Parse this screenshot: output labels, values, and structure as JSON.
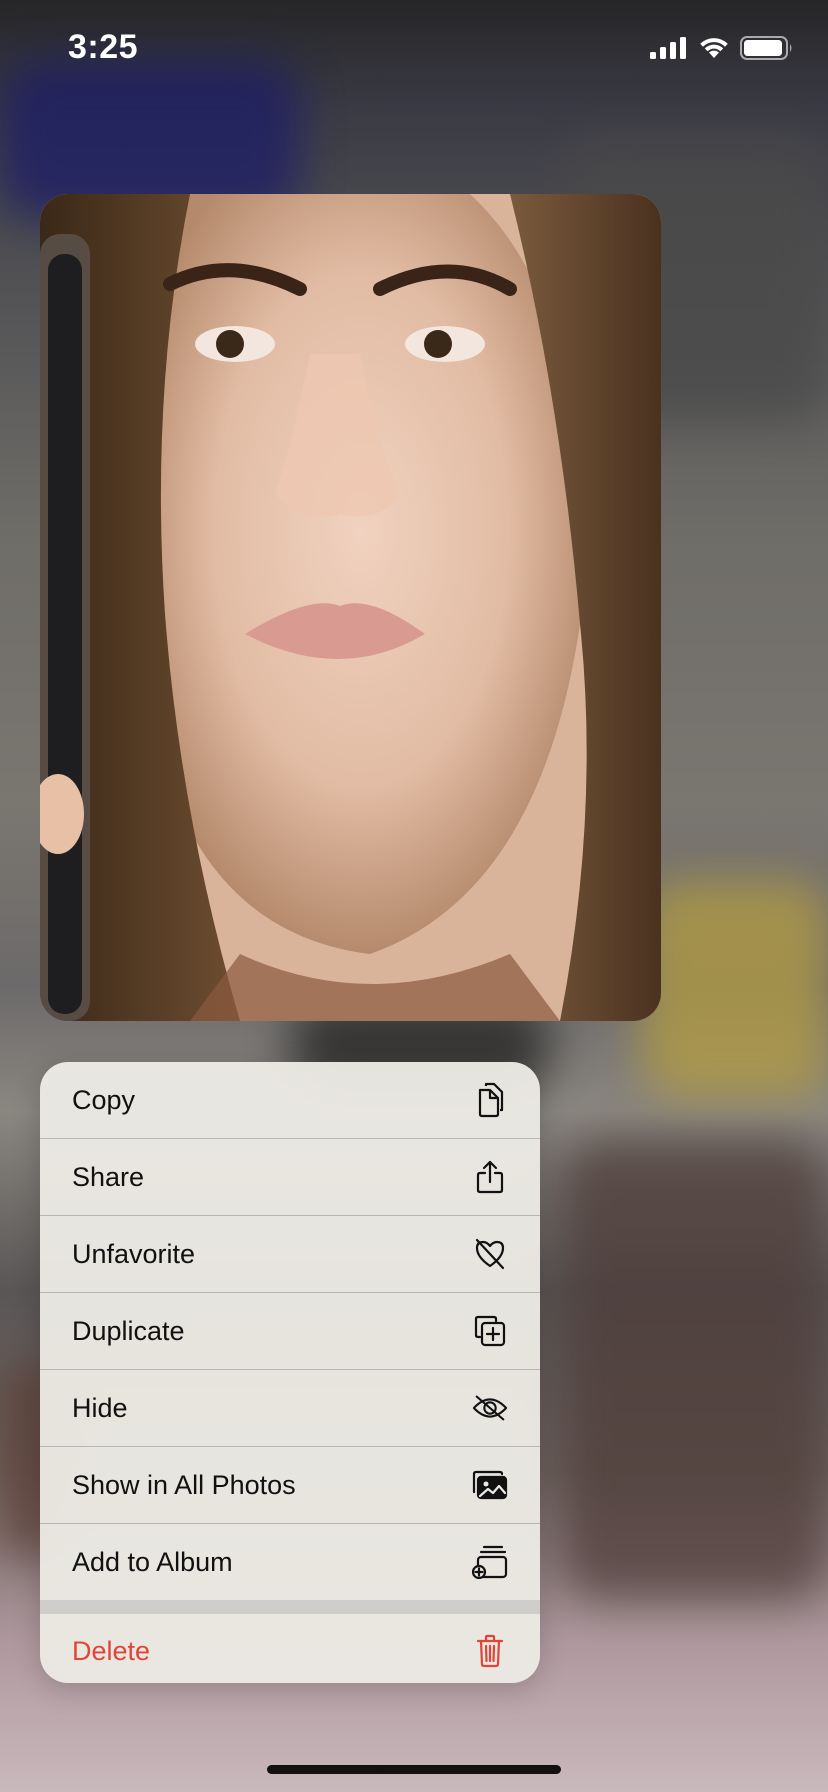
{
  "status_bar": {
    "time": "3:25",
    "icons": [
      "cellular-signal-icon",
      "wifi-icon",
      "battery-icon"
    ]
  },
  "preview": {
    "description_icon": "photo-preview"
  },
  "menu": {
    "items": [
      {
        "label": "Copy",
        "icon": "copy-icon"
      },
      {
        "label": "Share",
        "icon": "share-icon"
      },
      {
        "label": "Unfavorite",
        "icon": "heart-slash-icon"
      },
      {
        "label": "Duplicate",
        "icon": "duplicate-icon"
      },
      {
        "label": "Hide",
        "icon": "eye-slash-icon"
      },
      {
        "label": "Show in All Photos",
        "icon": "photos-icon"
      },
      {
        "label": "Add to Album",
        "icon": "add-to-album-icon"
      }
    ],
    "delete": {
      "label": "Delete",
      "icon": "trash-icon",
      "color": "#e0453a"
    }
  },
  "colors": {
    "destructive": "#e0453a",
    "menu_background": "#eceae4"
  }
}
